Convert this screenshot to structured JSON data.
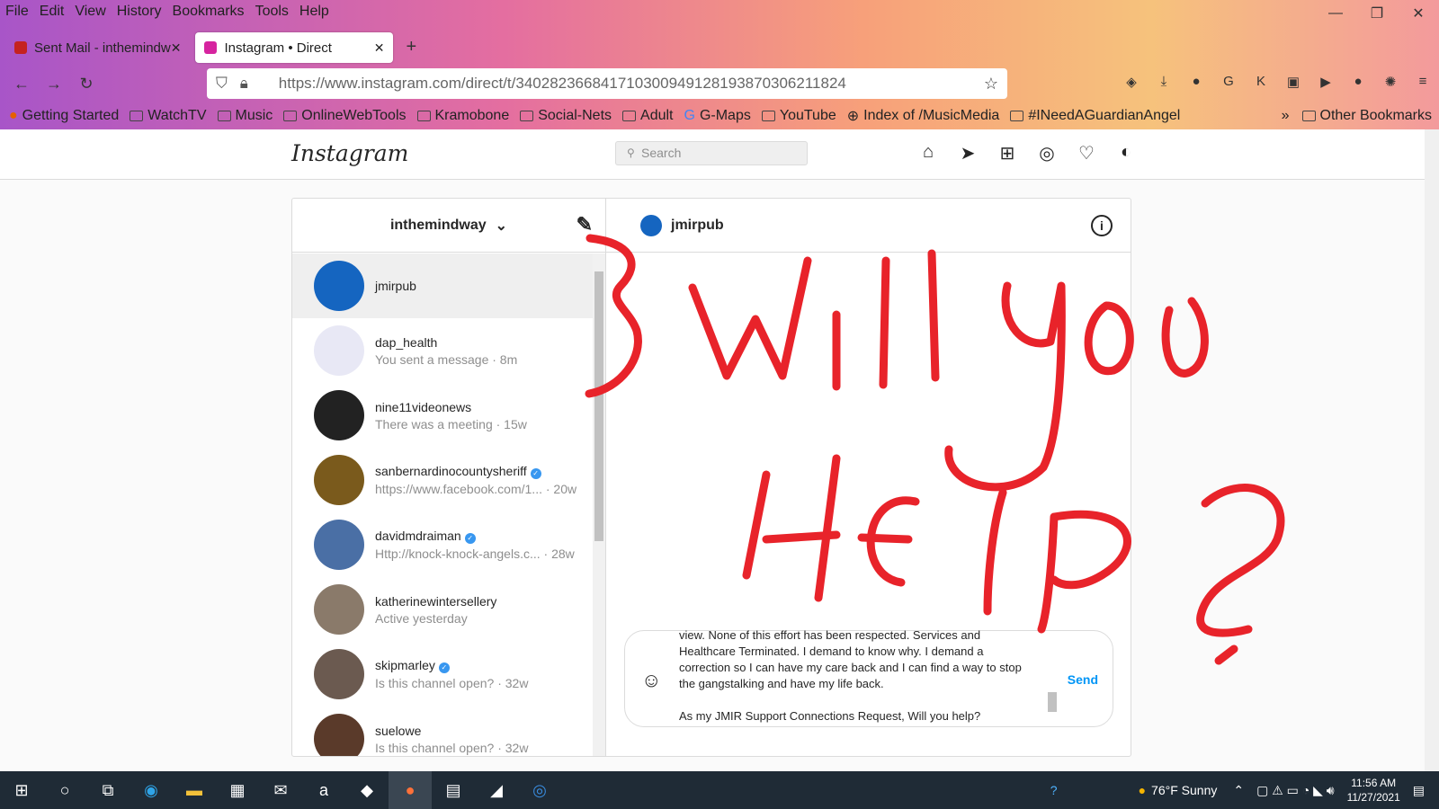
{
  "menu": [
    "File",
    "Edit",
    "View",
    "History",
    "Bookmarks",
    "Tools",
    "Help"
  ],
  "tabs": [
    {
      "label": "Sent Mail - inthemindw",
      "color": "#c5221f"
    },
    {
      "label": "Instagram • Direct",
      "color": "#d6249f"
    }
  ],
  "url": "https://www.instagram.com/direct/t/340282366841710300949128193870306211824",
  "bookmarks": [
    "Getting Started",
    "WatchTV",
    "Music",
    "OnlineWebTools",
    "Kramobone",
    "Social-Nets",
    "Adult",
    "G-Maps",
    "YouTube",
    "Index of /MusicMedia",
    "#INeedAGuardianAngel"
  ],
  "other_bookmarks": "Other Bookmarks",
  "instagram": {
    "logo": "Instagram",
    "search_placeholder": "Search",
    "account": "inthemindway",
    "chat_user": "jmirpub",
    "send": "Send",
    "conversations": [
      {
        "name": "jmirpub",
        "sub": "",
        "color": "#1565c0",
        "verified": false
      },
      {
        "name": "dap_health",
        "sub": "You sent a message · 8m",
        "color": "#e8e8f5",
        "verified": false
      },
      {
        "name": "nine11videonews",
        "sub": "There was a meeting · 15w",
        "color": "#222222",
        "verified": false
      },
      {
        "name": "sanbernardinocountysheriff",
        "sub": "https://www.facebook.com/1... · 20w",
        "color": "#7a5a1c",
        "verified": true
      },
      {
        "name": "davidmdraiman",
        "sub": "Http://knock-knock-angels.c... · 28w",
        "color": "#4a6fa5",
        "verified": true
      },
      {
        "name": "katherinewintersellery",
        "sub": "Active yesterday",
        "color": "#8a7a6a",
        "verified": false
      },
      {
        "name": "skipmarley",
        "sub": "Is this channel open? · 32w",
        "color": "#6b5a50",
        "verified": true
      },
      {
        "name": "suelowe",
        "sub": "Is this channel open? · 32w",
        "color": "#5a3a2a",
        "verified": false
      }
    ],
    "message_lines": [
      "view.  None of this effort has been respected.  Services and",
      "Healthcare Terminated.  I demand to know why. I demand a",
      "correction so I can have my care back and I can find a way to stop",
      "the gangstalking and have my life back.",
      "",
      "As my JMIR Support Connections Request, Will you help?"
    ]
  },
  "taskbar": {
    "weather": "76°F  Sunny",
    "time": "11:56 AM",
    "date": "11/27/2021"
  },
  "annotation_color": "#e8232a"
}
